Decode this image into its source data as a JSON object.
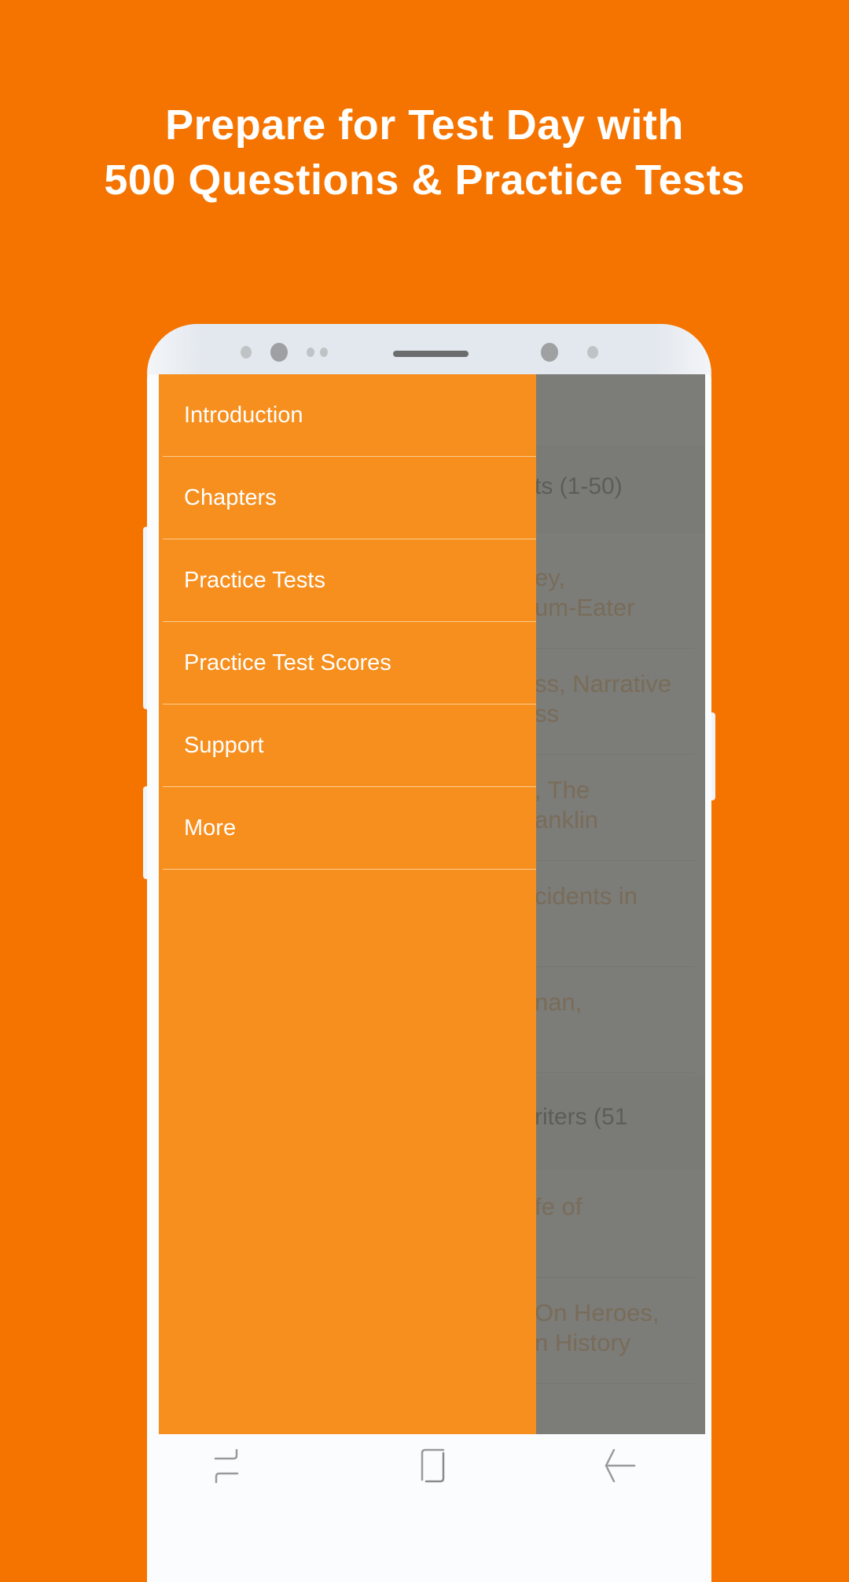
{
  "headline": {
    "line1": "Prepare for Test Day with",
    "line2": "500 Questions & Practice Tests"
  },
  "colors": {
    "background": "#F57400",
    "drawer": "#F78F1E",
    "drawer_text": "#FFFFFF",
    "link_text": "#E98B26",
    "dim_overlay": "#666662"
  },
  "drawer": {
    "items": [
      {
        "label": "Introduction"
      },
      {
        "label": "Chapters"
      },
      {
        "label": "Practice Tests"
      },
      {
        "label": "Practice Test Scores"
      },
      {
        "label": "Support"
      },
      {
        "label": "More"
      }
    ]
  },
  "background_list": {
    "sections": [
      {
        "title": "ts (1-50)"
      },
      {
        "title": "riters (51"
      }
    ],
    "rows": [
      {
        "line1": "ey,",
        "line2": "um-Eater"
      },
      {
        "line1": "ss, Narrative",
        "line2": "ss"
      },
      {
        "line1": ", The",
        "line2": "anklin"
      },
      {
        "line1": "cidents in",
        "line2": ""
      },
      {
        "line1": "nan,",
        "line2": ""
      },
      {
        "line1": "fe of",
        "line2": ""
      },
      {
        "line1": "On Heroes,",
        "line2": "n History"
      }
    ]
  },
  "navbar": {
    "recent_icon": "recent-apps-icon",
    "home_icon": "home-icon",
    "back_icon": "back-arrow-icon"
  }
}
